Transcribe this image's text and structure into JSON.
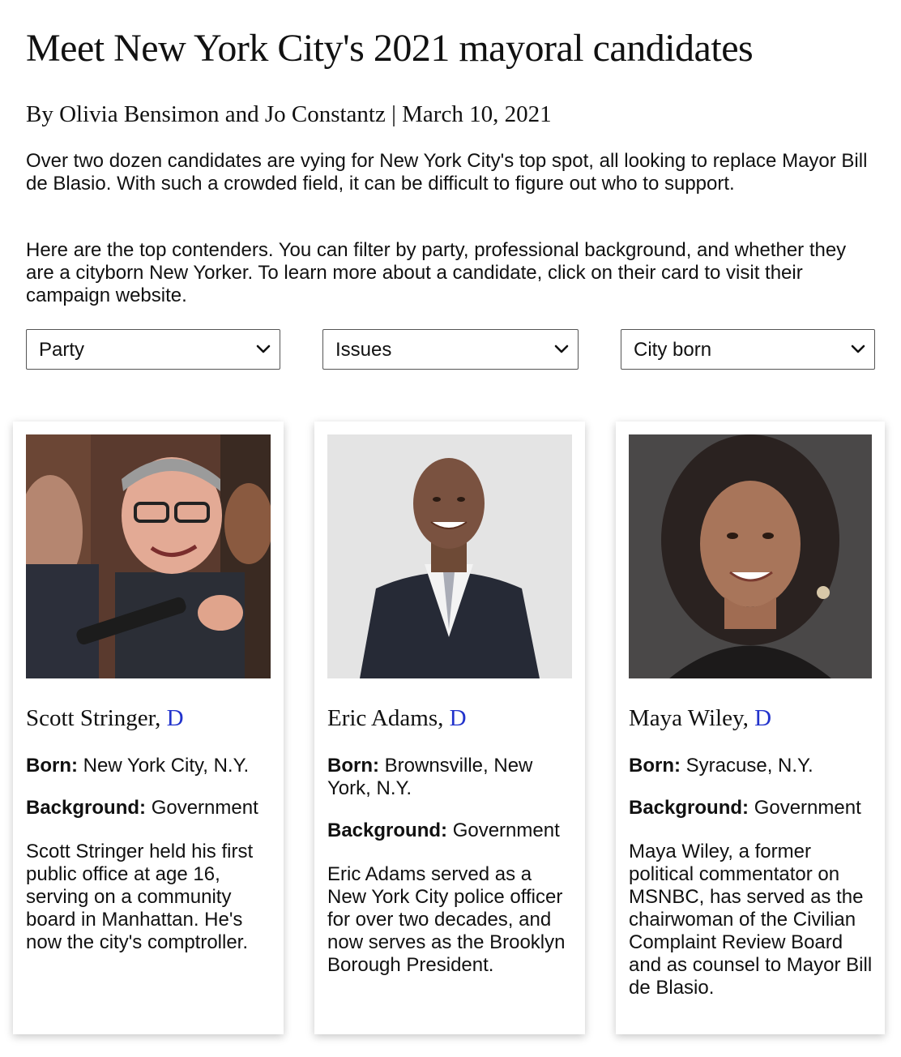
{
  "header": {
    "title": "Meet New York City's 2021 mayoral candidates",
    "byline": "By Olivia Bensimon and Jo Constantz | March 10, 2021"
  },
  "intro": {
    "p1": "Over two dozen candidates are vying for New York City's top spot, all looking to replace Mayor Bill de Blasio. With such a crowded field, it can be difficult to figure out who to support.",
    "p2": "Here are the top contenders. You can filter by party, professional background, and whether they are a cityborn New Yorker. To learn more about a candidate, click on their card to visit their campaign website."
  },
  "filters": {
    "party": "Party",
    "issues": "Issues",
    "city_born": "City born",
    "chevron_icon": "chevron-down-icon"
  },
  "labels": {
    "born": "Born:",
    "background": "Background:"
  },
  "candidates": [
    {
      "name": "Scott Stringer,",
      "party": "D",
      "born": "New York City, N.Y.",
      "background": "Government",
      "description": "Scott Stringer held his first public office at age 16, serving on a community board in Manhattan. He's now the city's comptroller."
    },
    {
      "name": "Eric Adams,",
      "party": "D",
      "born": "Brownsville, New York, N.Y.",
      "background": "Government",
      "description": "Eric Adams served as a New York City police officer for over two decades, and now serves as the Brooklyn Borough President."
    },
    {
      "name": "Maya Wiley,",
      "party": "D",
      "born": "Syracuse, N.Y.",
      "background": "Government",
      "description": "Maya Wiley, a former political commentator on MSNBC, has served as the chairwoman of the Civilian Complaint Review Board and as counsel to Mayor Bill de Blasio."
    }
  ],
  "colors": {
    "party_d": "#2233cc",
    "text": "#111111",
    "card_bg": "#ffffff"
  }
}
